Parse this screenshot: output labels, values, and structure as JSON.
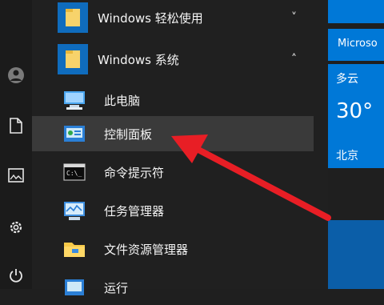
{
  "start_menu": {
    "groups": [
      {
        "label": "Windows 轻松使用",
        "icon": "folder-icon",
        "chevron": "˅"
      },
      {
        "label": "Windows 系统",
        "icon": "folder-icon",
        "chevron": "˄"
      }
    ],
    "items": [
      {
        "label": "此电脑",
        "icon": "this-pc-icon"
      },
      {
        "label": "控制面板",
        "icon": "control-panel-icon"
      },
      {
        "label": "命令提示符",
        "icon": "command-prompt-icon"
      },
      {
        "label": "任务管理器",
        "icon": "task-manager-icon"
      },
      {
        "label": "文件资源管理器",
        "icon": "file-explorer-icon"
      },
      {
        "label": "运行",
        "icon": "run-icon"
      }
    ]
  },
  "tiles": {
    "microsoft_label": "Microso",
    "weather": {
      "condition": "多云",
      "temperature": "30°",
      "city": "北京"
    }
  },
  "colors": {
    "tile_blue": "#0078d7",
    "highlight": "#3a3a3a",
    "arrow": "#e81e25"
  }
}
